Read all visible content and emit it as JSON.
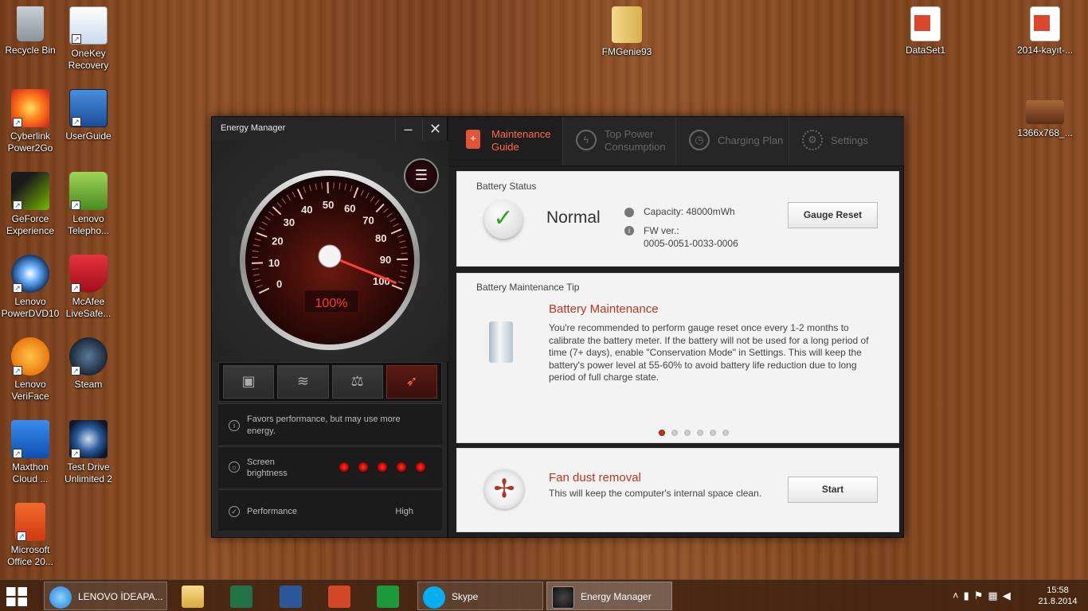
{
  "desktop": {
    "icons": [
      {
        "name": "recycle-bin",
        "label": "Recycle Bin",
        "color": "#9aa4ad"
      },
      {
        "name": "onekey-recovery",
        "label": "OneKey Recovery",
        "color": "#1f6fc4"
      },
      {
        "name": "cyberlink-power2go",
        "label": "Cyberlink Power2Go",
        "color": "#d8362a"
      },
      {
        "name": "userguide",
        "label": "UserGuide",
        "color": "#2f73c9"
      },
      {
        "name": "geforce-experience",
        "label": "GeForce Experience",
        "color": "#3b7a1f"
      },
      {
        "name": "lenovo-telephony",
        "label": "Lenovo Telepho...",
        "color": "#6ba53b"
      },
      {
        "name": "lenovo-powerdvd10",
        "label": "Lenovo PowerDVD10",
        "color": "#1b3f7a"
      },
      {
        "name": "mcafee-livesafe",
        "label": "McAfee LiveSafe...",
        "color": "#c01f2c"
      },
      {
        "name": "lenovo-veriface",
        "label": "Lenovo VeriFace",
        "color": "#e77d10"
      },
      {
        "name": "steam",
        "label": "Steam",
        "color": "#1b2838"
      },
      {
        "name": "maxthon-cloud",
        "label": "Maxthon Cloud ...",
        "color": "#1a6fd6"
      },
      {
        "name": "test-drive-unlimited-2",
        "label": "Test Drive Unlimited 2",
        "color": "#15355e"
      },
      {
        "name": "microsoft-office",
        "label": "Microsoft Office 20...",
        "color": "#e2471c"
      },
      {
        "name": "fmgenie93",
        "label": "FMGenie93",
        "color": "#e7c36a"
      },
      {
        "name": "dataset1",
        "label": "DataSet1",
        "color": "#d9482c"
      },
      {
        "name": "2014-kayit",
        "label": "2014-kayıt-...",
        "color": "#d9482c"
      },
      {
        "name": "1366x768",
        "label": "1366x768_...",
        "color": "#7a4a2a"
      }
    ]
  },
  "window": {
    "title": "Energy Manager",
    "minimize": "–",
    "close": "✕",
    "gauge": {
      "ticks": [
        "0",
        "10",
        "20",
        "30",
        "40",
        "50",
        "60",
        "70",
        "80",
        "90",
        "100"
      ],
      "level_percent": 100,
      "readout": "100%"
    },
    "modes": [
      "quiet-mode",
      "battery-saving-mode",
      "balanced-mode",
      "performance-mode"
    ],
    "active_mode": 3,
    "mode_desc": "Favors performance, but may use more energy.",
    "screen_brightness_label": "Screen brightness",
    "brightness_level": 5,
    "performance_label": "Performance",
    "performance_value": "High"
  },
  "tabs": [
    {
      "label": "Maintenance Guide",
      "icon": "battery-icon",
      "active": true
    },
    {
      "label": "Top Power Consumption",
      "icon": "power-icon",
      "active": false
    },
    {
      "label": "Charging Plan",
      "icon": "clock-icon",
      "active": false
    },
    {
      "label": "Settings",
      "icon": "gear-icon",
      "active": false
    }
  ],
  "battery_status": {
    "heading": "Battery Status",
    "status": "Normal",
    "capacity": "Capacity: 48000mWh",
    "fw_label": "FW ver.:",
    "fw_value": "0005-0051-0033-0006",
    "gauge_reset": "Gauge Reset"
  },
  "tip": {
    "heading": "Battery Maintenance Tip",
    "title": "Battery Maintenance",
    "body": "You're recommended to perform gauge reset once every 1-2 months to calibrate the battery meter. If the battery will not be used for a long period of time (7+ days), enable \"Conservation Mode\" in Settings. This will keep the battery's power level at 55-60% to avoid battery life reduction due to long period of full charge state.",
    "pages": 6,
    "current_page": 0
  },
  "fan": {
    "title": "Fan dust removal",
    "body": "This will keep the computer's internal space clean.",
    "start": "Start"
  },
  "taskbar": {
    "ie_label": "LENOVO İDEAPA...",
    "skype_label": "Skype",
    "em_label": "Energy Manager",
    "time": "15:58",
    "date": "21.8.2014"
  },
  "colors": {
    "accent": "#e2553a",
    "title_red": "#c0341e",
    "gauge_red": "#ff3a2a"
  }
}
